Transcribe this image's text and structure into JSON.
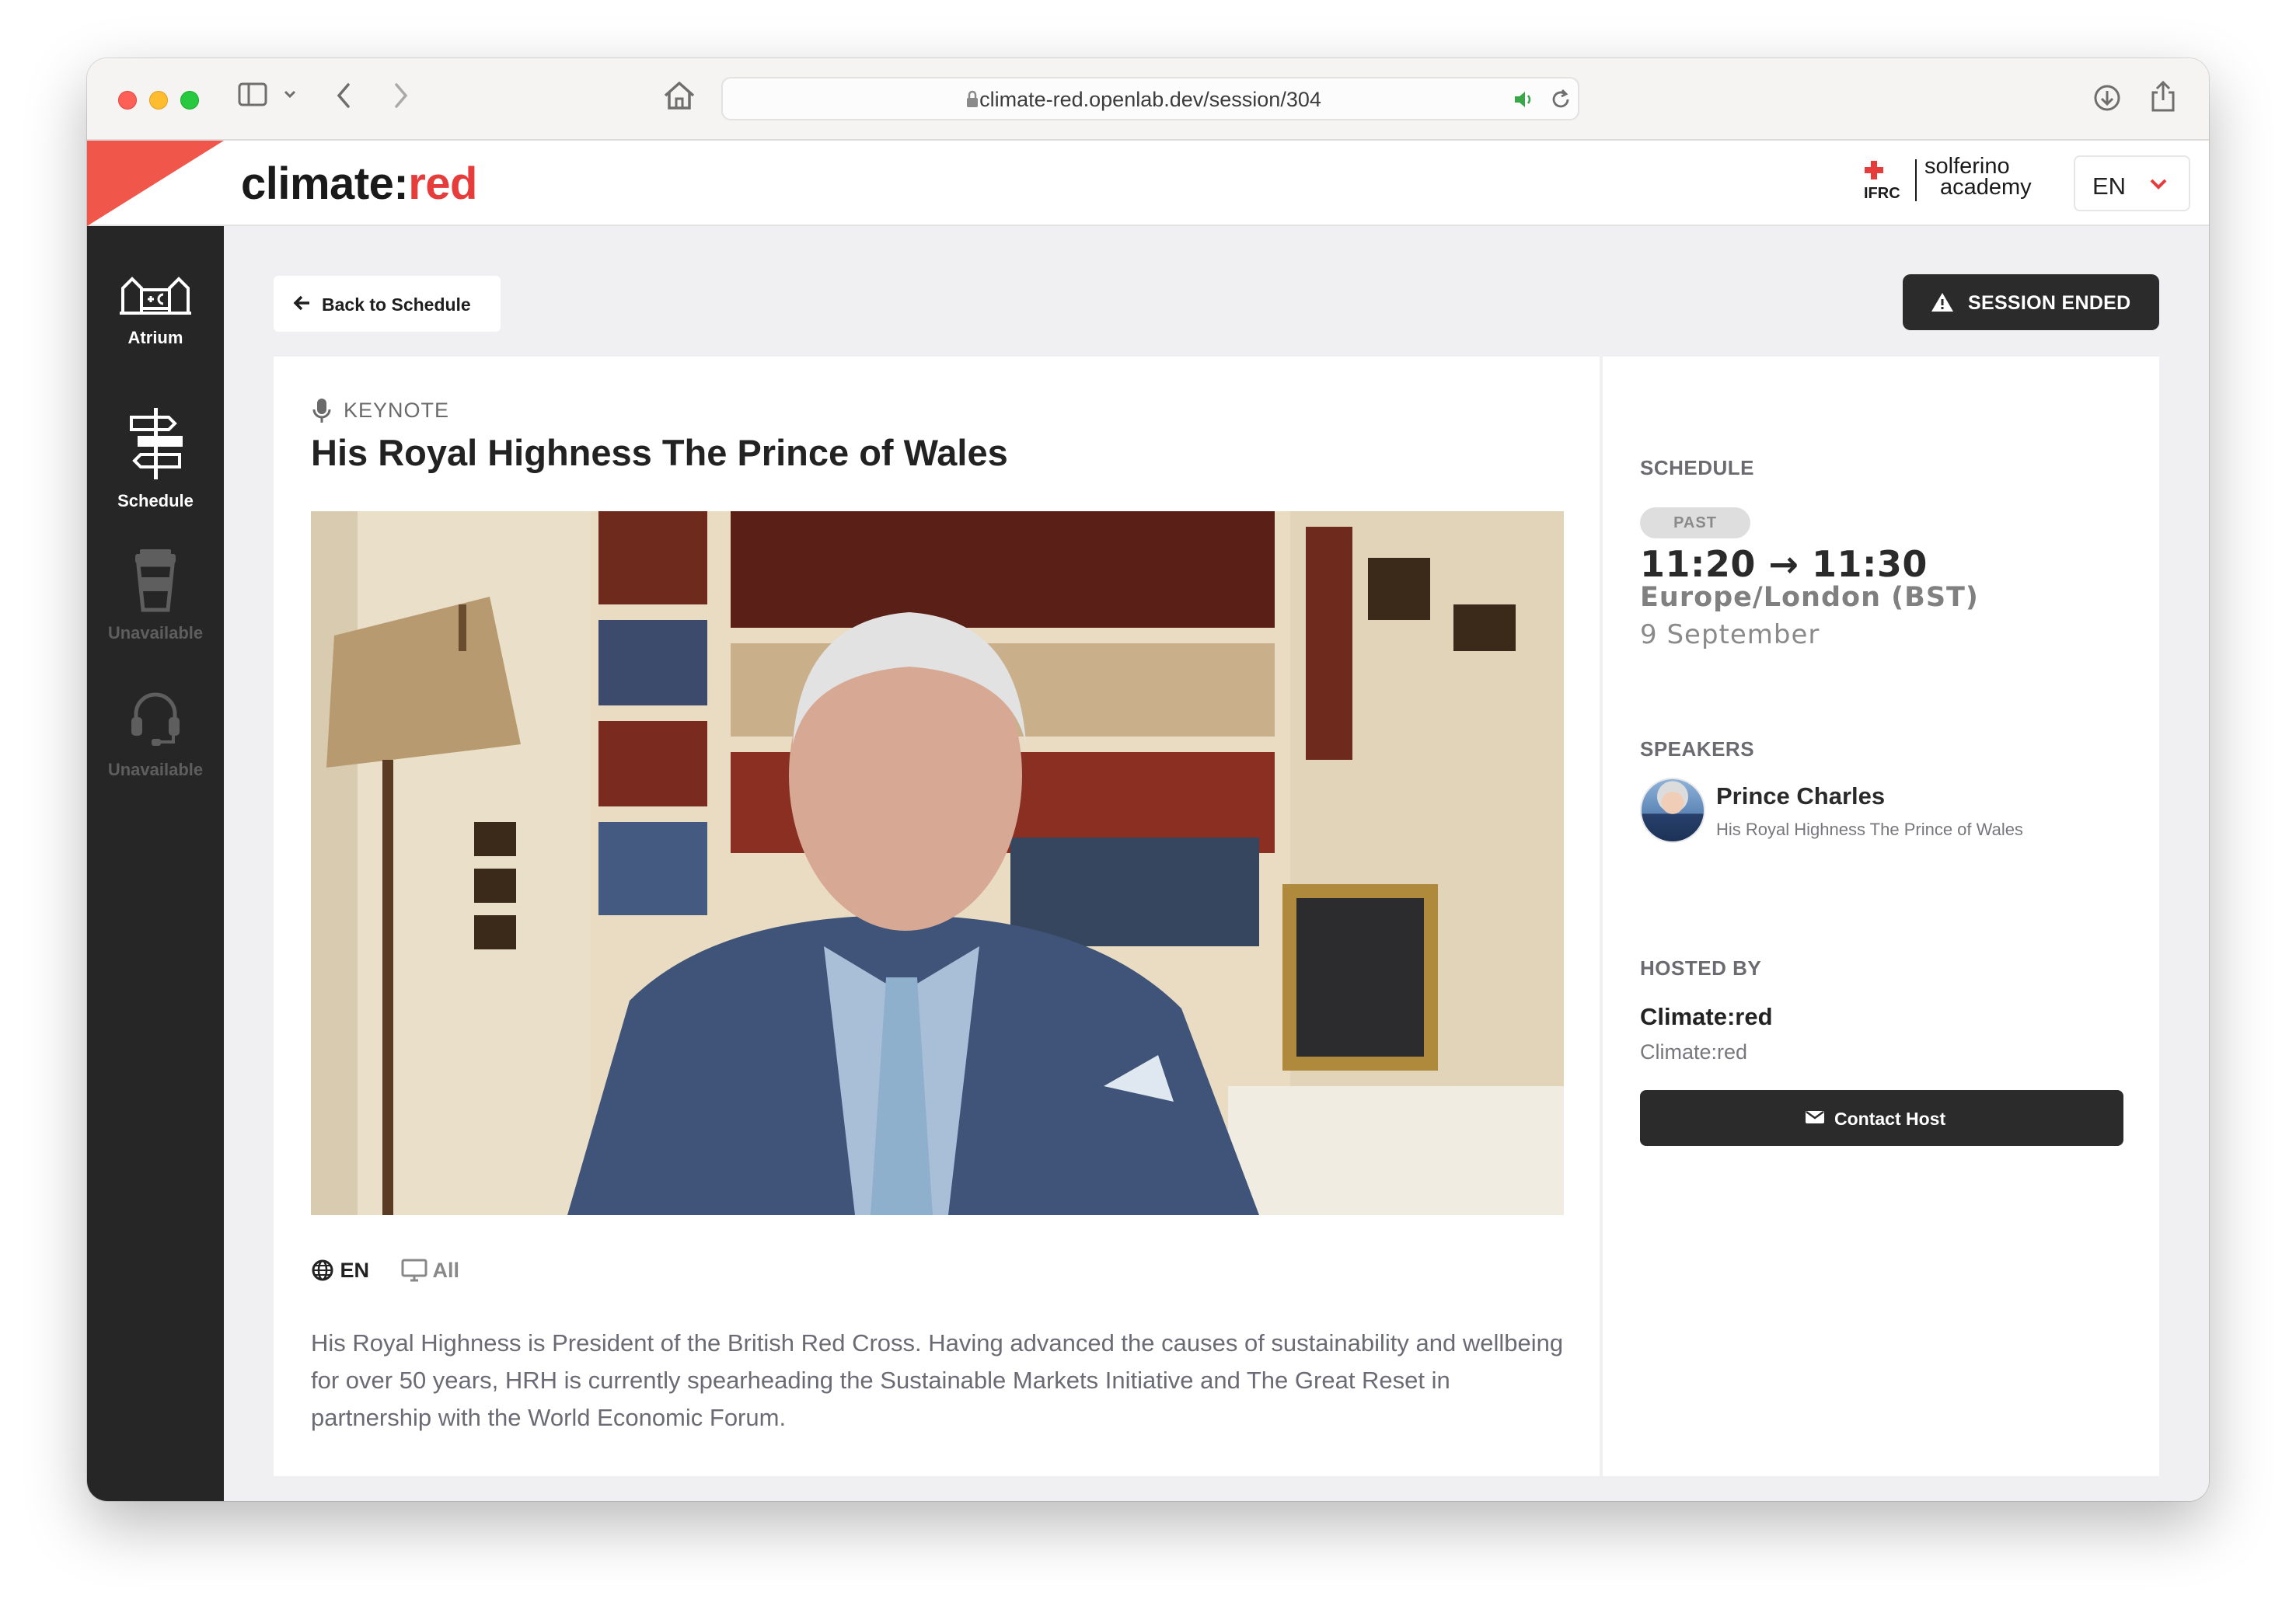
{
  "browser": {
    "url": "climate-red.openlab.dev/session/304"
  },
  "header": {
    "logo_main": "climate:",
    "logo_accent": "red",
    "partner_mark_text": "IFRC",
    "partner_name_line1": "solferino",
    "partner_name_line2": "academy",
    "language": "EN"
  },
  "sidebar": {
    "items": [
      {
        "label": "Atrium",
        "icon": "atrium-icon",
        "state": "active"
      },
      {
        "label": "Schedule",
        "icon": "schedule-signpost-icon",
        "state": "active"
      },
      {
        "label": "Unavailable",
        "icon": "coffee-cup-icon",
        "state": "disabled"
      },
      {
        "label": "Unavailable",
        "icon": "headset-icon",
        "state": "disabled"
      }
    ]
  },
  "toolbar": {
    "back_label": "Back to Schedule",
    "status_label": "SESSION ENDED"
  },
  "session": {
    "type": "KEYNOTE",
    "title": "His Royal Highness The Prince of Wales",
    "language": "EN",
    "audience": "All",
    "description": "His Royal Highness is President of the British Red Cross. Having advanced the causes of sustainability and wellbeing for over 50 years, HRH is currently spearheading the Sustainable Markets Initiative and The Great Reset in partnership with the World Economic Forum."
  },
  "schedule": {
    "heading": "SCHEDULE",
    "badge": "PAST",
    "time_range": "11:20 → 11:30",
    "timezone": "Europe/London (BST)",
    "date": "9 September"
  },
  "speakers": {
    "heading": "SPEAKERS",
    "items": [
      {
        "name": "Prince Charles",
        "role": "His Royal Highness The Prince of Wales"
      }
    ]
  },
  "host": {
    "heading": "HOSTED BY",
    "name": "Climate:red",
    "subtitle": "Climate:red",
    "contact_label": "Contact Host"
  },
  "colors": {
    "accent_red": "#e63c3c",
    "sidebar_bg": "#262626",
    "button_dark": "#2b2b2b",
    "page_bg": "#f0f0f2"
  }
}
